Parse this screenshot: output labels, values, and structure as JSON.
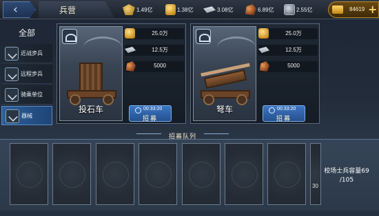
{
  "header": {
    "back_icon": "‹",
    "title": "兵营",
    "resources": [
      {
        "icon": "wheat-icon",
        "value": "1.49亿"
      },
      {
        "icon": "gold-ore-icon",
        "value": "1.38亿"
      },
      {
        "icon": "silver-icon",
        "value": "3.08亿"
      },
      {
        "icon": "iron-ore-icon",
        "value": "6.89亿"
      },
      {
        "icon": "coin-icon",
        "value": "2.55亿"
      }
    ],
    "gold": {
      "value": "84619",
      "plus": "+"
    }
  },
  "sidebar": {
    "all_label": "全部",
    "items": [
      {
        "label": "近战步兵",
        "active": false
      },
      {
        "label": "远程步兵",
        "active": false
      },
      {
        "label": "骑乘单位",
        "active": false
      },
      {
        "label": "器械",
        "active": true
      }
    ]
  },
  "units": [
    {
      "name": "投石车",
      "costs": [
        {
          "icon": "gold-ore-icon",
          "value": "25.0万"
        },
        {
          "icon": "silver-icon",
          "value": "12.5万"
        },
        {
          "icon": "iron-ore-icon",
          "value": "5000"
        }
      ],
      "time": "00:33:20",
      "recruit_label": "招募"
    },
    {
      "name": "弩车",
      "costs": [
        {
          "icon": "gold-ore-icon",
          "value": "25.0万"
        },
        {
          "icon": "silver-icon",
          "value": "12.5万"
        },
        {
          "icon": "iron-ore-icon",
          "value": "5000"
        }
      ],
      "time": "00:33:20",
      "recruit_label": "招募"
    }
  ],
  "queue": {
    "title": "招募队列",
    "slot_count": 7,
    "partial_slot_text": "30",
    "capacity_label": "校场士兵容量69",
    "capacity_total": "/105"
  },
  "colors": {
    "accent_blue": "#2c5f99",
    "gold": "#c98b1c",
    "background": "#1c2634"
  }
}
